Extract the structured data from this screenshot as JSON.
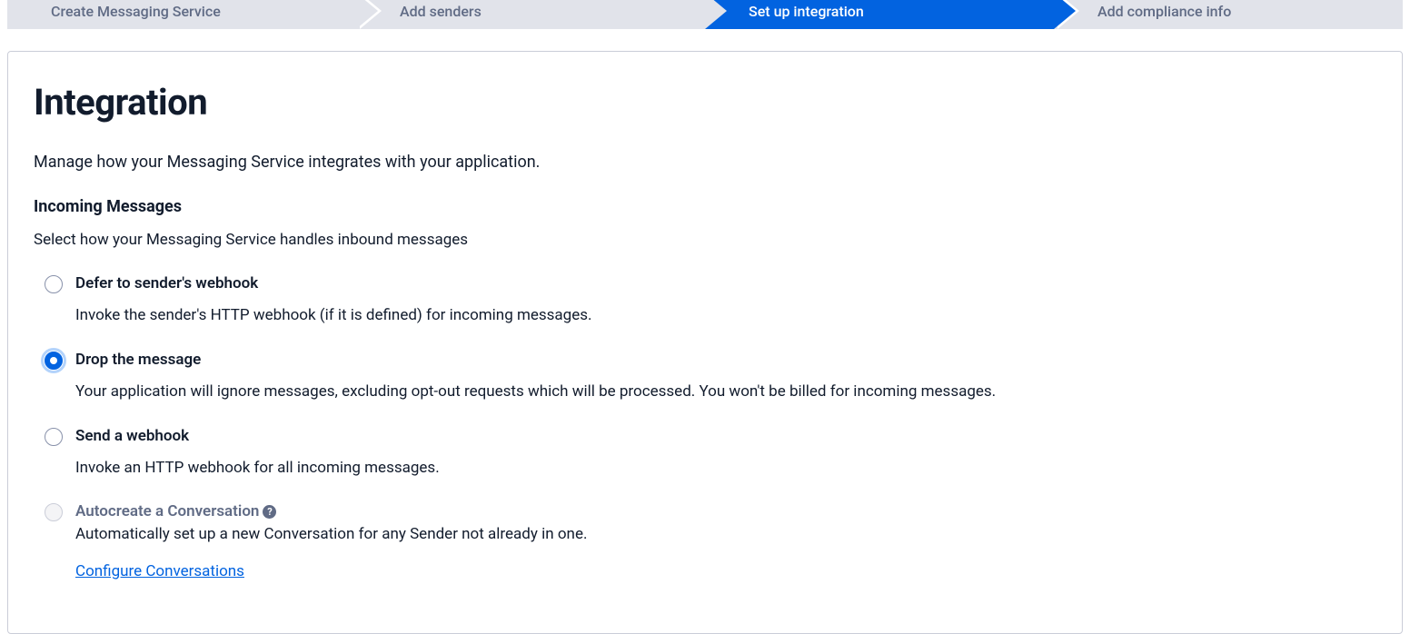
{
  "stepper": {
    "steps": [
      {
        "label": "Create Messaging Service",
        "active": false
      },
      {
        "label": "Add senders",
        "active": false
      },
      {
        "label": "Set up integration",
        "active": true
      },
      {
        "label": "Add compliance info",
        "active": false
      }
    ]
  },
  "page": {
    "title": "Integration",
    "intro": "Manage how your Messaging Service integrates with your application.",
    "section_heading": "Incoming Messages",
    "section_intro": "Select how your Messaging Service handles inbound messages"
  },
  "options": [
    {
      "label": "Defer to sender's webhook",
      "desc": "Invoke the sender's HTTP webhook (if it is defined) for incoming messages.",
      "selected": false,
      "disabled": false
    },
    {
      "label": "Drop the message",
      "desc": "Your application will ignore messages, excluding opt-out requests which will be processed. You won't be billed for incoming messages.",
      "selected": true,
      "disabled": false
    },
    {
      "label": "Send a webhook",
      "desc": "Invoke an HTTP webhook for all incoming messages.",
      "selected": false,
      "disabled": false
    },
    {
      "label": "Autocreate a Conversation",
      "desc": "Automatically set up a new Conversation for any Sender not already in one.",
      "selected": false,
      "disabled": true,
      "help": true,
      "link": "Configure Conversations"
    }
  ]
}
